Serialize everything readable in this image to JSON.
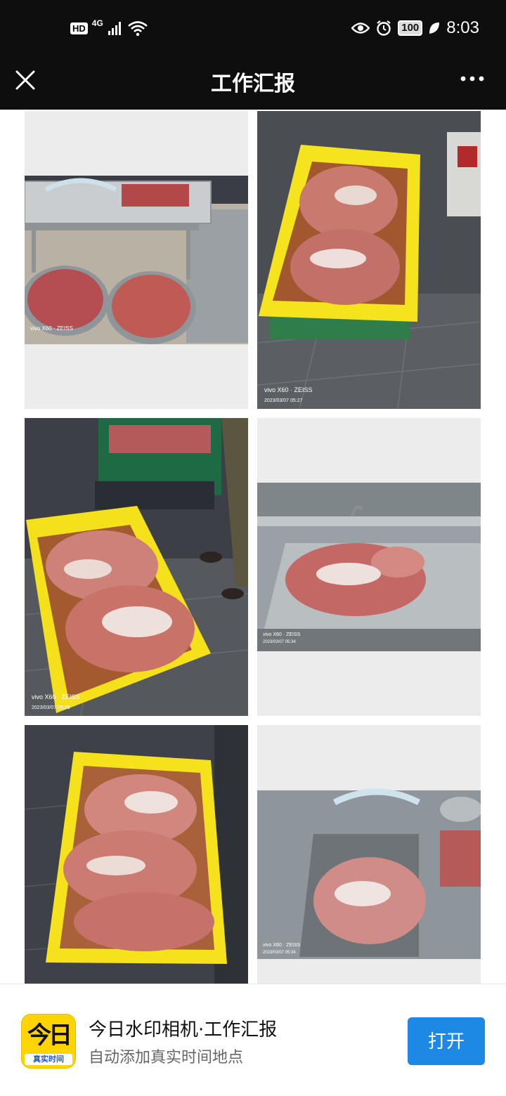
{
  "status_bar": {
    "hd": "HD",
    "network": "4G",
    "battery": "100",
    "time": "8:03"
  },
  "nav": {
    "title": "工作汇报",
    "close_icon": "close-icon",
    "more_icon": "more-icon"
  },
  "photos": [
    {
      "description_icon": "photo-meat-bowls",
      "watermark": "vivo X60 · ZEISS"
    },
    {
      "description_icon": "photo-yellow-crate",
      "watermark": "vivo X60 · ZEISS",
      "timestamp": "2023/03/07 05:27"
    },
    {
      "description_icon": "photo-crate-floor",
      "watermark": "vivo X60 · ZEISS",
      "timestamp": "2023/03/07 05:28"
    },
    {
      "description_icon": "photo-steel-table",
      "watermark": "vivo X60 · ZEISS",
      "timestamp": "2023/03/07 05:34"
    },
    {
      "description_icon": "photo-crate-full",
      "watermark": ""
    },
    {
      "description_icon": "photo-sink",
      "watermark": "vivo X60 · ZEISS",
      "timestamp": "2023/03/07 05:34"
    }
  ],
  "banner": {
    "icon_text": "今日",
    "icon_sub": "真实时间",
    "title": "今日水印相机·工作汇报",
    "subtitle": "自动添加真实时间地点",
    "open_label": "打开"
  },
  "colors": {
    "bar_bg": "#0e0e0e",
    "button_blue": "#1e88e5",
    "icon_yellow": "#ffd400"
  }
}
